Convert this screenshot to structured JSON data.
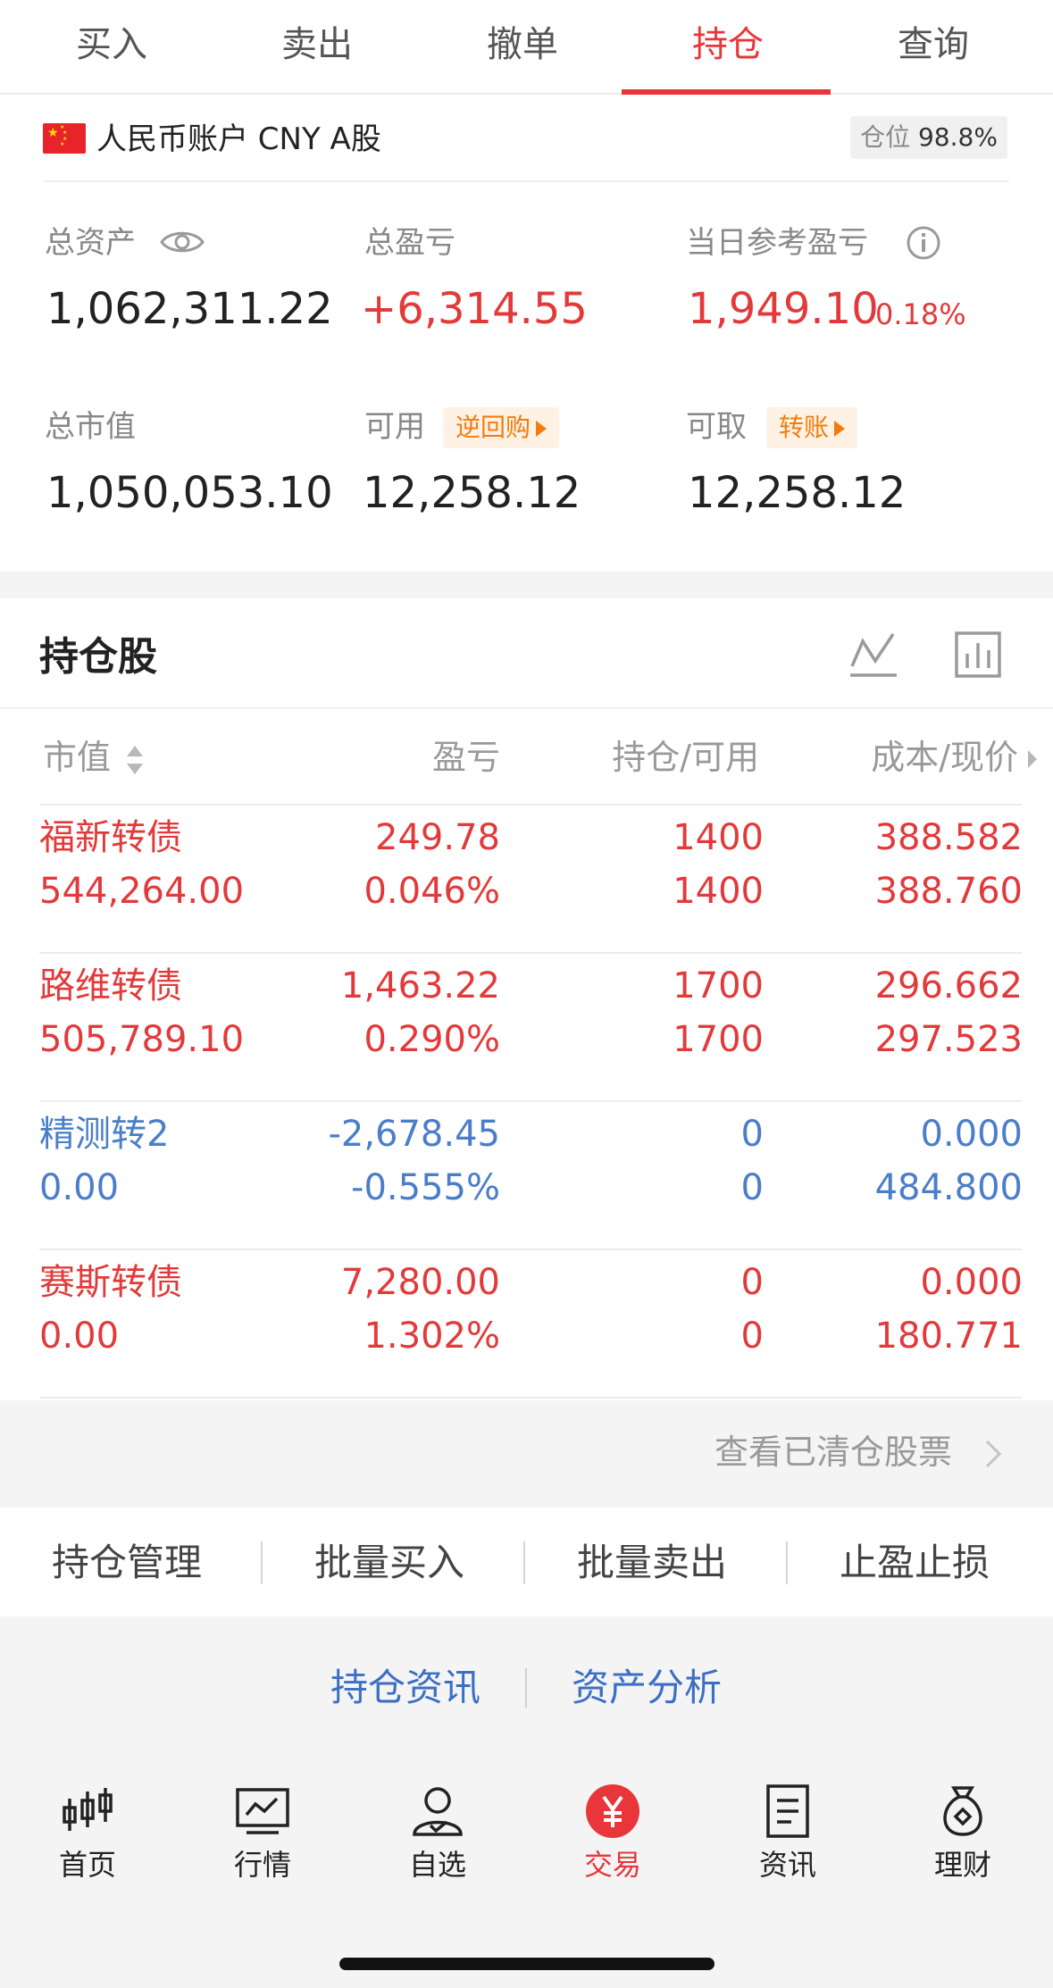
{
  "tabs": [
    {
      "label": "买入"
    },
    {
      "label": "卖出"
    },
    {
      "label": "撤单"
    },
    {
      "label": "持仓",
      "active": true
    },
    {
      "label": "查询"
    }
  ],
  "account": {
    "name": "人民币账户 CNY A股",
    "position_label": "仓位",
    "position_value": "98.8%"
  },
  "summary": {
    "total_assets_label": "总资产",
    "total_assets": "1,062,311.22",
    "total_pl_label": "总盈亏",
    "total_pl": "+6,314.55",
    "daily_pl_label": "当日参考盈亏",
    "daily_pl": "1,949.10",
    "daily_pl_pct": "0.18%",
    "market_value_label": "总市值",
    "market_value": "1,050,053.10",
    "available_label": "可用",
    "available_badge": "逆回购",
    "available": "12,258.12",
    "withdrawable_label": "可取",
    "withdrawable_badge": "转账",
    "withdrawable": "12,258.12"
  },
  "holdings": {
    "title": "持仓股",
    "columns": [
      "市值",
      "盈亏",
      "持仓/可用",
      "成本/现价"
    ],
    "rows": [
      {
        "name": "福新转债",
        "market_value": "544,264.00",
        "pl": "249.78",
        "pl_pct": "0.046%",
        "position": "1400",
        "available": "1400",
        "cost": "388.582",
        "price": "388.760",
        "color": "#e23a3a"
      },
      {
        "name": "路维转债",
        "market_value": "505,789.10",
        "pl": "1,463.22",
        "pl_pct": "0.290%",
        "position": "1700",
        "available": "1700",
        "cost": "296.662",
        "price": "297.523",
        "color": "#e23a3a"
      },
      {
        "name": "精测转2",
        "market_value": "0.00",
        "pl": "-2,678.45",
        "pl_pct": "-0.555%",
        "position": "0",
        "available": "0",
        "cost": "0.000",
        "price": "484.800",
        "color": "#4a7ec8"
      },
      {
        "name": "赛斯转债",
        "market_value": "0.00",
        "pl": "7,280.00",
        "pl_pct": "1.302%",
        "position": "0",
        "available": "0",
        "cost": "0.000",
        "price": "180.771",
        "color": "#e23a3a"
      }
    ],
    "cleared_link": "查看已清仓股票"
  },
  "actions": [
    "持仓管理",
    "批量买入",
    "批量卖出",
    "止盈止损"
  ],
  "links": [
    "持仓资讯",
    "资产分析"
  ],
  "nav": [
    {
      "label": "首页",
      "icon": "candlestick-icon"
    },
    {
      "label": "行情",
      "icon": "chart-monitor-icon"
    },
    {
      "label": "自选",
      "icon": "user-icon"
    },
    {
      "label": "交易",
      "icon": "yuan-icon",
      "active": true
    },
    {
      "label": "资讯",
      "icon": "document-icon"
    },
    {
      "label": "理财",
      "icon": "money-bag-icon"
    }
  ],
  "colors": {
    "accent": "#e8363a",
    "loss": "#4a7ec8",
    "badge": "#f07d10"
  }
}
